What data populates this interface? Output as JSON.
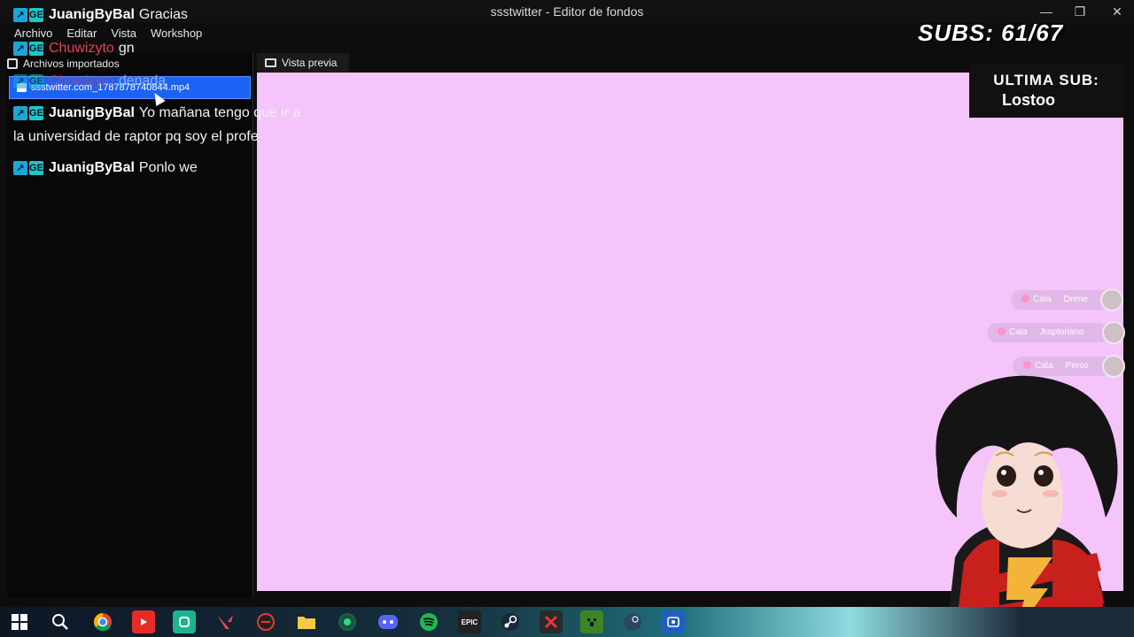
{
  "window": {
    "title": "ssstwitter - Editor de fondos",
    "minimize_glyph": "—",
    "maximize_glyph": "❐",
    "close_glyph": "✕"
  },
  "menu": {
    "items": [
      "Archivo",
      "Editar",
      "Vista",
      "Workshop"
    ]
  },
  "panel": {
    "tab_label": "Archivos importados",
    "file_name": "ssstwitter.com_1787878740844.mp4"
  },
  "preview": {
    "tab_label": "Vista previa",
    "background_color": "#f4c4fa"
  },
  "chat": {
    "badge1": "↗",
    "badge2": "GE",
    "messages": [
      {
        "user": "JuanigByBal",
        "text": "Gracias"
      },
      {
        "user": "Chuwizyto",
        "text": "gn"
      },
      {
        "user": "Chuwizyto",
        "text": "denada"
      },
      {
        "user": "JuanigByBal",
        "text": "Yo mañana tengo que ir a",
        "continuation": "la universidad de raptor pq soy el profe"
      },
      {
        "user": "JuanigByBal",
        "text": "Ponlo we"
      }
    ]
  },
  "overlay": {
    "subs_label": "SUBS: 61/67",
    "last_sub_label": "ULTIMA SUB:",
    "last_sub_name": "Lostoo"
  },
  "voice": {
    "pills": [
      {
        "label": "Cala",
        "name": "Drene"
      },
      {
        "label": "Cala",
        "name": "Jraptoriano"
      },
      {
        "label": "Cala",
        "name": "Perso"
      }
    ]
  },
  "taskbar": {
    "icons": [
      "windows-start",
      "search",
      "chrome",
      "youtube",
      "app-green",
      "valorant",
      "app-red",
      "files",
      "app-green2",
      "discord",
      "spotify",
      "epic",
      "steam",
      "app-x",
      "minecraft",
      "app-steam2",
      "app-blue"
    ],
    "epic_label": "EPIC"
  }
}
